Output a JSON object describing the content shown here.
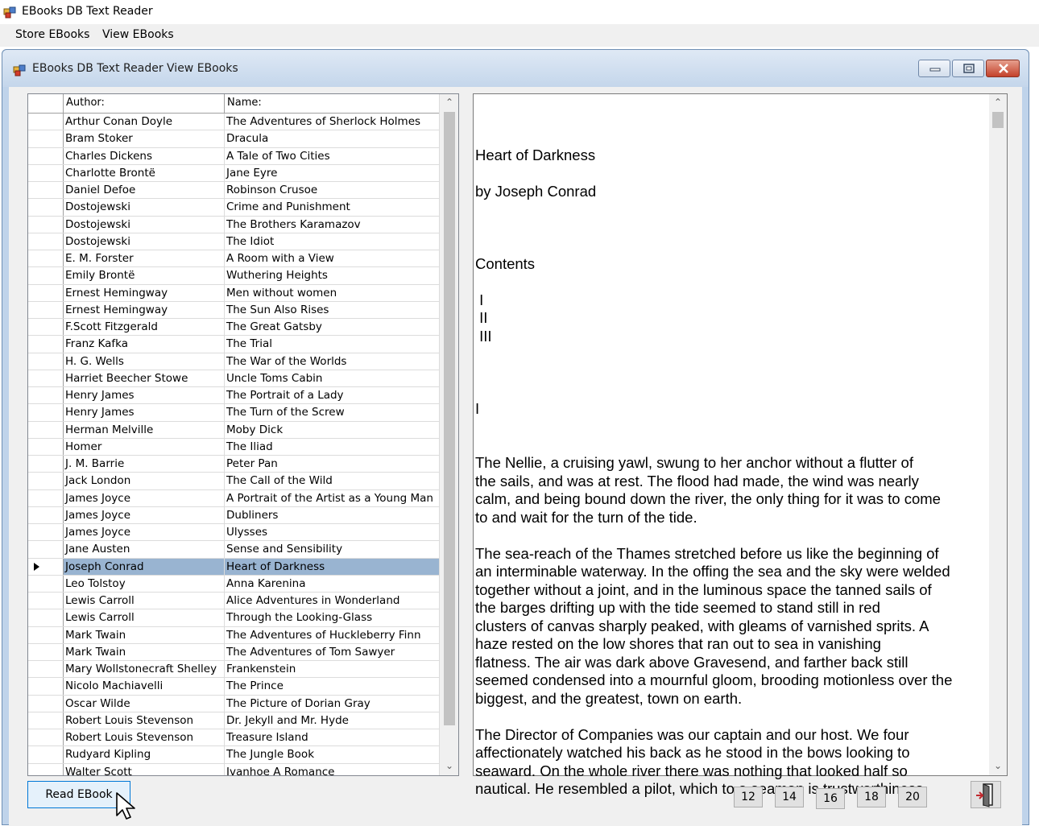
{
  "app": {
    "title": "EBooks DB Text Reader",
    "menu": [
      "Store EBooks",
      "View EBooks"
    ]
  },
  "child_window": {
    "title": "EBooks DB Text Reader View EBooks"
  },
  "grid": {
    "headers": [
      "Author:",
      "Name:"
    ],
    "selected_index": 26,
    "rows": [
      [
        "Arthur Conan Doyle",
        "The Adventures of Sherlock Holmes"
      ],
      [
        "Bram Stoker",
        "Dracula"
      ],
      [
        "Charles Dickens",
        "A Tale of Two Cities"
      ],
      [
        "Charlotte Brontë",
        "Jane Eyre"
      ],
      [
        "Daniel Defoe",
        "Robinson Crusoe"
      ],
      [
        "Dostojewski",
        "Crime and Punishment"
      ],
      [
        "Dostojewski",
        "The Brothers Karamazov"
      ],
      [
        "Dostojewski",
        "The Idiot"
      ],
      [
        "E. M. Forster",
        "A Room with a View"
      ],
      [
        "Emily Brontë",
        "Wuthering Heights"
      ],
      [
        "Ernest Hemingway",
        "Men without women"
      ],
      [
        "Ernest Hemingway",
        "The Sun Also Rises"
      ],
      [
        "F.Scott Fitzgerald",
        "The Great Gatsby"
      ],
      [
        "Franz Kafka",
        "The Trial"
      ],
      [
        "H. G. Wells",
        "The War of the Worlds"
      ],
      [
        "Harriet Beecher Stowe",
        "Uncle Toms Cabin"
      ],
      [
        "Henry James",
        "The Portrait of a Lady"
      ],
      [
        "Henry James",
        "The Turn of the Screw"
      ],
      [
        "Herman Melville",
        "Moby Dick"
      ],
      [
        "Homer",
        "The Iliad"
      ],
      [
        "J. M. Barrie",
        "Peter Pan"
      ],
      [
        "Jack London",
        "The Call of the Wild"
      ],
      [
        "James Joyce",
        "A Portrait of the Artist as a Young Man"
      ],
      [
        "James Joyce",
        "Dubliners"
      ],
      [
        "James Joyce",
        "Ulysses"
      ],
      [
        "Jane Austen",
        "Sense and Sensibility"
      ],
      [
        "Joseph Conrad",
        "Heart of Darkness"
      ],
      [
        "Leo Tolstoy",
        "Anna Karenina"
      ],
      [
        "Lewis Carroll",
        "Alice Adventures in Wonderland"
      ],
      [
        "Lewis Carroll",
        "Through the Looking-Glass"
      ],
      [
        "Mark Twain",
        "The Adventures of Huckleberry Finn"
      ],
      [
        "Mark Twain",
        "The Adventures of Tom Sawyer"
      ],
      [
        "Mary Wollstonecraft Shelley",
        "Frankenstein"
      ],
      [
        "Nicolo Machiavelli",
        "The Prince"
      ],
      [
        "Oscar Wilde",
        "The Picture of Dorian Gray"
      ],
      [
        "Robert Louis Stevenson",
        "Dr. Jekyll and Mr. Hyde"
      ],
      [
        "Robert Louis Stevenson",
        "Treasure Island"
      ],
      [
        "Rudyard Kipling",
        "The Jungle Book"
      ],
      [
        "Walter Scott",
        "Ivanhoe A Romance"
      ]
    ]
  },
  "reader": {
    "lines": [
      "",
      "Heart of Darkness",
      "",
      "by Joseph Conrad",
      "",
      "",
      "",
      "Contents",
      "",
      " I",
      " II",
      " III",
      "",
      "",
      "",
      "I",
      "",
      "",
      "The Nellie, a cruising yawl, swung to her anchor without a flutter of",
      "the sails, and was at rest. The flood had made, the wind was nearly",
      "calm, and being bound down the river, the only thing for it was to come",
      "to and wait for the turn of the tide.",
      "",
      "The sea-reach of the Thames stretched before us like the beginning of",
      "an interminable waterway. In the offing the sea and the sky were welded",
      "together without a joint, and in the luminous space the tanned sails of",
      "the barges drifting up with the tide seemed to stand still in red",
      "clusters of canvas sharply peaked, with gleams of varnished sprits. A",
      "haze rested on the low shores that ran out to sea in vanishing",
      "flatness. The air was dark above Gravesend, and farther back still",
      "seemed condensed into a mournful gloom, brooding motionless over the",
      "biggest, and the greatest, town on earth.",
      "",
      "The Director of Companies was our captain and our host. We four",
      "affectionately watched his back as he stood in the bows looking to",
      "seaward. On the whole river there was nothing that looked half so",
      "nautical. He resembled a pilot, which to a seaman is trustworthiness"
    ]
  },
  "buttons": {
    "read": "Read EBook",
    "sizes": [
      "12",
      "14",
      "16",
      "18",
      "20"
    ]
  },
  "icons": {
    "app": "form-icon",
    "exit": "exit-door-icon",
    "cursor": "mouse-pointer-icon"
  },
  "colors": {
    "selection": "#99b4d1",
    "titlebar": "#c4d6eb",
    "close": "#c4412b"
  }
}
